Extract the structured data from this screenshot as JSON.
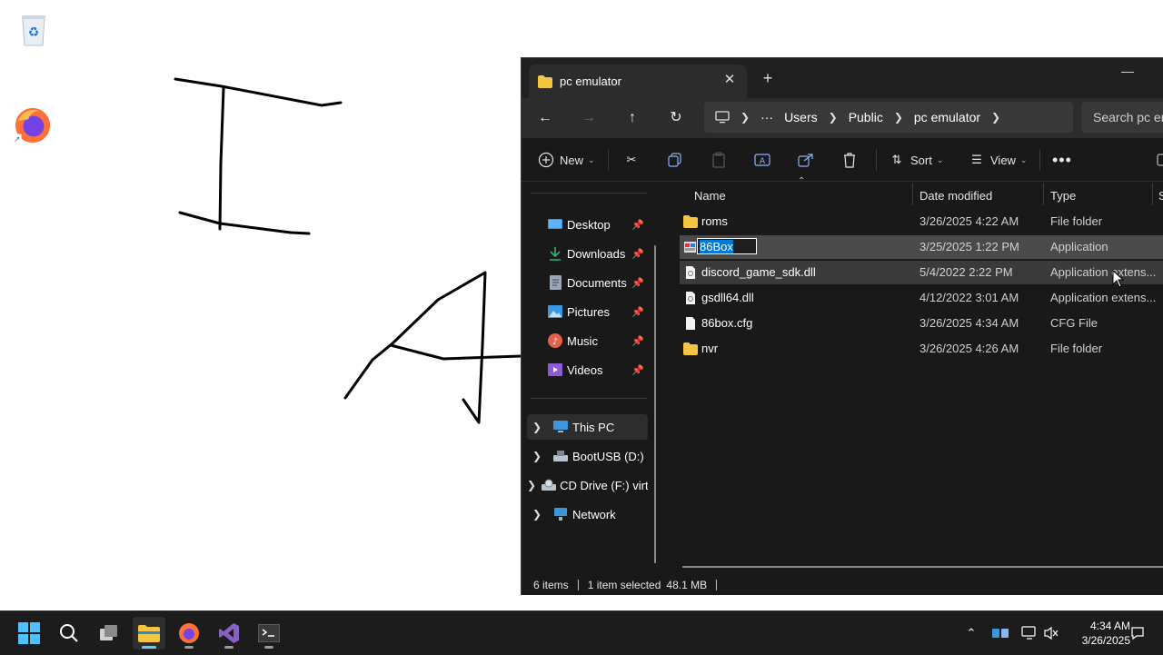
{
  "explorer": {
    "tab_title": "pc emulator",
    "breadcrumbs": [
      "Users",
      "Public",
      "pc emulator"
    ],
    "search_placeholder": "Search pc em",
    "toolbar": {
      "new_label": "New",
      "sort_label": "Sort",
      "view_label": "View"
    },
    "sidebar": {
      "quick_access": [
        {
          "label": "Desktop",
          "icon": "desktop-icon"
        },
        {
          "label": "Downloads",
          "icon": "download-icon"
        },
        {
          "label": "Documents",
          "icon": "documents-icon"
        },
        {
          "label": "Pictures",
          "icon": "pictures-icon"
        },
        {
          "label": "Music",
          "icon": "music-icon"
        },
        {
          "label": "Videos",
          "icon": "videos-icon"
        }
      ],
      "drives": [
        {
          "label": "This PC",
          "icon": "pc-icon",
          "selected": true
        },
        {
          "label": "BootUSB (D:)",
          "icon": "usb-drive-icon"
        },
        {
          "label": "CD Drive (F:) virt",
          "icon": "cd-drive-icon"
        },
        {
          "label": "Network",
          "icon": "network-icon"
        }
      ]
    },
    "columns": {
      "name": "Name",
      "date": "Date modified",
      "type": "Type",
      "size": "S"
    },
    "files": [
      {
        "name": "roms",
        "date": "3/26/2025 4:22 AM",
        "type": "File folder",
        "icon": "folder-icon"
      },
      {
        "name": "86Box",
        "date": "3/25/2025 1:22 PM",
        "type": "Application",
        "icon": "app-icon",
        "renaming": true
      },
      {
        "name": "discord_game_sdk.dll",
        "date": "5/4/2022 2:22 PM",
        "type": "Application extens...",
        "icon": "dll-icon"
      },
      {
        "name": "gsdll64.dll",
        "date": "4/12/2022 3:01 AM",
        "type": "Application extens...",
        "icon": "dll-icon"
      },
      {
        "name": "86box.cfg",
        "date": "3/26/2025 4:34 AM",
        "type": "CFG File",
        "icon": "file-icon"
      },
      {
        "name": "nvr",
        "date": "3/26/2025 4:26 AM",
        "type": "File folder",
        "icon": "folder-icon"
      }
    ],
    "status": {
      "count": "6 items",
      "selected": "1 item selected",
      "size": "48.1 MB"
    }
  },
  "taskbar": {
    "time": "4:34 AM",
    "date": "3/26/2025"
  },
  "colors": {
    "accent": "#0078d4",
    "folder": "#f4c542",
    "taskbar_indicator": "#60cdff"
  }
}
